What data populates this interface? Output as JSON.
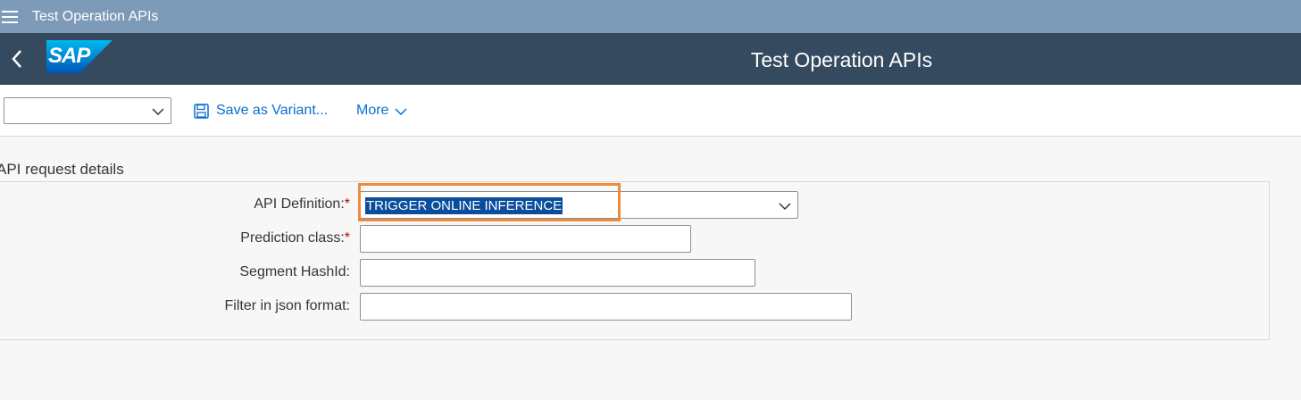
{
  "window": {
    "title": "Test Operation APIs"
  },
  "shell": {
    "back_icon": "chevron-left-icon",
    "logo_text": "SAP",
    "page_title": "Test Operation APIs"
  },
  "toolbar": {
    "variant_value": "",
    "save_variant_label": "Save as Variant...",
    "save_icon": "floppy-disk-icon",
    "more_label": "More"
  },
  "section": {
    "title": "API request details"
  },
  "form": {
    "api_definition": {
      "label": "API Definition:",
      "required_marker": "*",
      "value": "TRIGGER ONLINE INFERENCE"
    },
    "prediction_class": {
      "label": "Prediction class:",
      "required_marker": "*",
      "value": ""
    },
    "segment_hashid": {
      "label": "Segment HashId:",
      "value": ""
    },
    "filter_json": {
      "label": "Filter in json format:",
      "value": ""
    }
  },
  "colors": {
    "titlebar": "#7d9ab8",
    "shell": "#354a5f",
    "accent": "#0a6ed1",
    "highlight": "#ef8a3a",
    "required": "#bb0000"
  }
}
